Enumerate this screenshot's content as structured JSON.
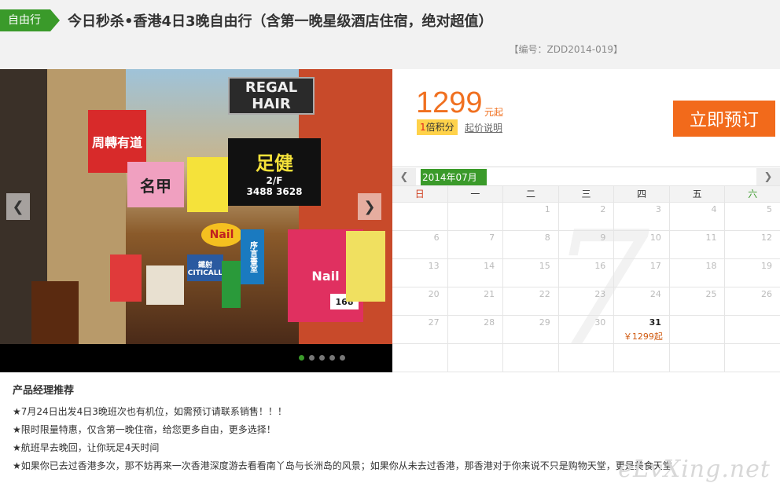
{
  "header": {
    "tag": "自由行",
    "title": "今日秒杀•香港4日3晚自由行（含第一晚星级酒店住宿，绝对超值）",
    "code": "【编号：ZDD2014-019】"
  },
  "gallery": {
    "signs": [
      "REGAL HAIR",
      "足健",
      "2/F",
      "3488 3628",
      "Nail",
      "周轉有道",
      "名甲",
      "序言書室",
      "Nail",
      "CITICALL",
      "鐵射",
      "168"
    ],
    "dot_count": 5,
    "active_dot": 1
  },
  "price": {
    "amount": "1299",
    "unit": "元起",
    "points_num": "1",
    "points_text": "倍积分",
    "note": "起价说明",
    "book_label": "立即预订"
  },
  "calendar": {
    "month": "2014年07月",
    "watermark": "7",
    "weekdays": [
      "日",
      "一",
      "二",
      "三",
      "四",
      "五",
      "六"
    ],
    "weeks": [
      [
        {
          "d": ""
        },
        {
          "d": ""
        },
        {
          "d": "1"
        },
        {
          "d": "2"
        },
        {
          "d": "3"
        },
        {
          "d": "4"
        },
        {
          "d": "5"
        }
      ],
      [
        {
          "d": "6"
        },
        {
          "d": "7"
        },
        {
          "d": "8"
        },
        {
          "d": "9"
        },
        {
          "d": "10"
        },
        {
          "d": "11"
        },
        {
          "d": "12"
        }
      ],
      [
        {
          "d": "13"
        },
        {
          "d": "14"
        },
        {
          "d": "15"
        },
        {
          "d": "16"
        },
        {
          "d": "17"
        },
        {
          "d": "18"
        },
        {
          "d": "19"
        }
      ],
      [
        {
          "d": "20"
        },
        {
          "d": "21"
        },
        {
          "d": "22"
        },
        {
          "d": "23"
        },
        {
          "d": "24"
        },
        {
          "d": "25"
        },
        {
          "d": "26"
        }
      ],
      [
        {
          "d": "27"
        },
        {
          "d": "28"
        },
        {
          "d": "29"
        },
        {
          "d": "30"
        },
        {
          "d": "31",
          "price": "￥1299起"
        },
        {
          "d": ""
        },
        {
          "d": ""
        }
      ],
      [
        {
          "d": ""
        },
        {
          "d": ""
        },
        {
          "d": ""
        },
        {
          "d": ""
        },
        {
          "d": ""
        },
        {
          "d": ""
        },
        {
          "d": ""
        }
      ]
    ]
  },
  "recommend": {
    "title": "产品经理推荐",
    "items": [
      "★7月24日出发4日3晚班次也有机位，如需预订请联系销售！！！",
      "★限时限量特惠，仅含第一晚住宿，给您更多自由，更多选择！",
      "★航班早去晚回，让你玩足4天时间",
      "★如果你已去过香港多次，那不妨再来一次香港深度游去看看南丫岛与长洲岛的风景；如果你从未去过香港，那香港对于你来说不只是购物天堂，更是美食天堂"
    ]
  },
  "watermark": "eLvXing.net"
}
